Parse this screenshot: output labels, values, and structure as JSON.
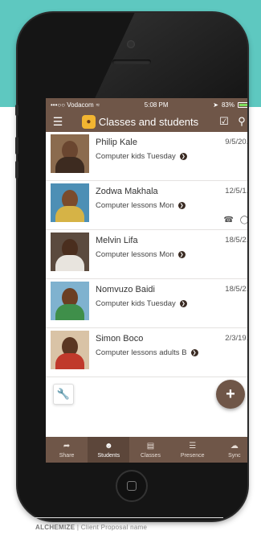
{
  "status_bar": {
    "carrier": "•••○○ Vodacom",
    "time": "5:08 PM",
    "battery": "83%"
  },
  "app_bar": {
    "title": "Classes and students"
  },
  "students": [
    {
      "name": "Philip Kale",
      "course": "Computer kids Tuesday",
      "date": "9/5/20..",
      "has_actions": false
    },
    {
      "name": "Zodwa Makhala",
      "course": "Computer lessons Mon",
      "date": "12/5/1..",
      "has_actions": true
    },
    {
      "name": "Melvin Lifa",
      "course": "Computer lessons Mon",
      "date": "18/5/2..",
      "has_actions": false
    },
    {
      "name": "Nomvuzo Baidi",
      "course": "Computer kids Tuesday",
      "date": "18/5/2..",
      "has_actions": false
    },
    {
      "name": "Simon Boco",
      "course": "Computer lessons adults B",
      "date": "2/3/19..",
      "has_actions": false
    }
  ],
  "tabs": [
    {
      "label": "Share",
      "icon": "share-icon"
    },
    {
      "label": "Students",
      "icon": "students-icon"
    },
    {
      "label": "Classes",
      "icon": "classes-icon"
    },
    {
      "label": "Presence",
      "icon": "presence-icon"
    },
    {
      "label": "Sync",
      "icon": "cloud-icon"
    }
  ],
  "active_tab": "Students",
  "footer": {
    "brand": "ALCHEMIZE",
    "text": "| Client Proposal name"
  },
  "colors": {
    "header": "#6f5648",
    "teal_background": "#5ec8c0"
  }
}
